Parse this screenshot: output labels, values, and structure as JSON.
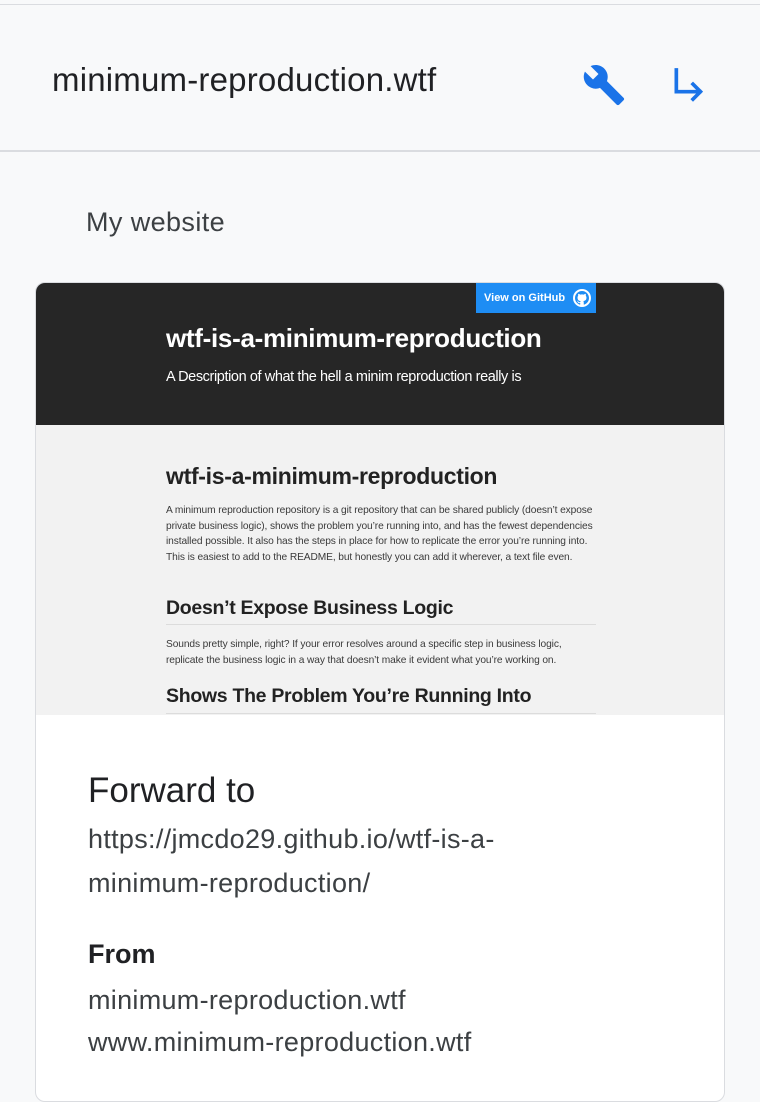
{
  "header": {
    "domain": "minimum-reproduction.wtf",
    "actions": [
      {
        "icon": "wrench-icon"
      },
      {
        "icon": "forward-arrow-icon"
      }
    ]
  },
  "section": {
    "title": "My website"
  },
  "preview": {
    "github_button": "View on GitHub",
    "hero_title": "wtf-is-a-minimum-reproduction",
    "hero_description": "A Description of what the hell a minim reproduction really is",
    "heading1": "wtf-is-a-minimum-reproduction",
    "paragraph1": "A minimum reproduction repository is a git repository that can be shared publicly (doesn’t expose private business logic), shows the problem you’re running into, and has the fewest dependencies installed possible. It also has the steps in place for how to replicate the error you’re running into. This is easiest to add to the README, but honestly you can add it wherever, a text file even.",
    "heading2": "Doesn’t Expose Business Logic",
    "paragraph2": "Sounds pretty simple, right? If your error resolves around a specific step in business logic, replicate the business logic in a way that doesn’t make it evident what you’re working on.",
    "heading3": "Shows The Problem You’re Running Into"
  },
  "forward": {
    "label": "Forward to",
    "url": "https://jmcdo29.github.io/wtf-is-a-minimum-reproduction/"
  },
  "from": {
    "label": "From",
    "domains": [
      "minimum-reproduction.wtf",
      "www.minimum-reproduction.wtf"
    ]
  },
  "colors": {
    "accent": "#1a73e8",
    "github_button": "#1e8df4",
    "hero_background": "#262626"
  }
}
